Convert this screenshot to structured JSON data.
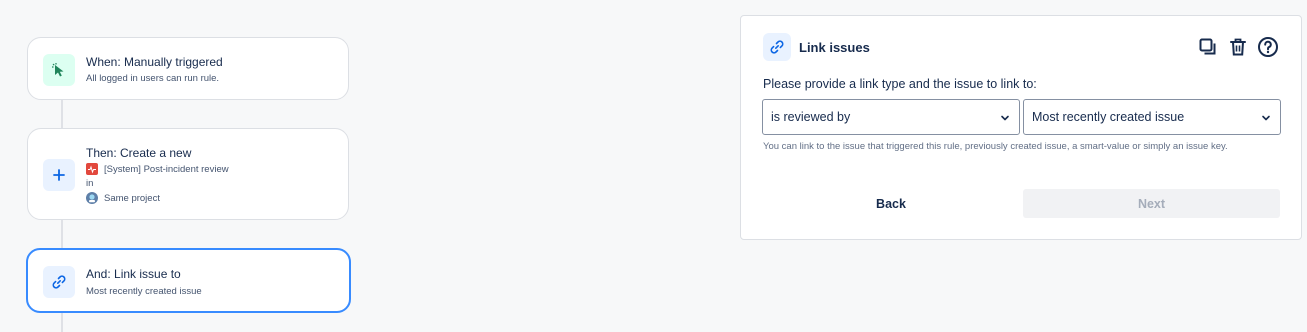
{
  "flow": {
    "trigger": {
      "title": "When: Manually triggered",
      "subtitle": "All logged in users can run rule."
    },
    "create": {
      "title": "Then: Create a new",
      "issue_type": "[System] Post-incident review",
      "in_label": "in",
      "project": "Same project"
    },
    "link": {
      "title": "And: Link issue to",
      "subtitle": "Most recently created issue"
    }
  },
  "panel": {
    "title": "Link issues",
    "prompt": "Please provide a link type and the issue to link to:",
    "link_type_value": "is reviewed by",
    "issue_value": "Most recently created issue",
    "help_text": "You can link to the issue that triggered this rule, previously created issue, a smart-value or simply an issue key.",
    "back_label": "Back",
    "next_label": "Next"
  },
  "icons": {
    "trigger": "cursor-click-icon",
    "create": "plus-icon",
    "link": "link-icon",
    "issue_type": "post-incident-review-icon",
    "project": "project-avatar-icon",
    "duplicate": "duplicate-icon",
    "delete": "trash-icon",
    "help": "help-icon",
    "chevron": "chevron-down-icon"
  },
  "colors": {
    "accent": "#388bff",
    "link_icon": "#0c66e4",
    "trigger_icon": "#1f845a",
    "issue_type_icon": "#e2483d"
  }
}
